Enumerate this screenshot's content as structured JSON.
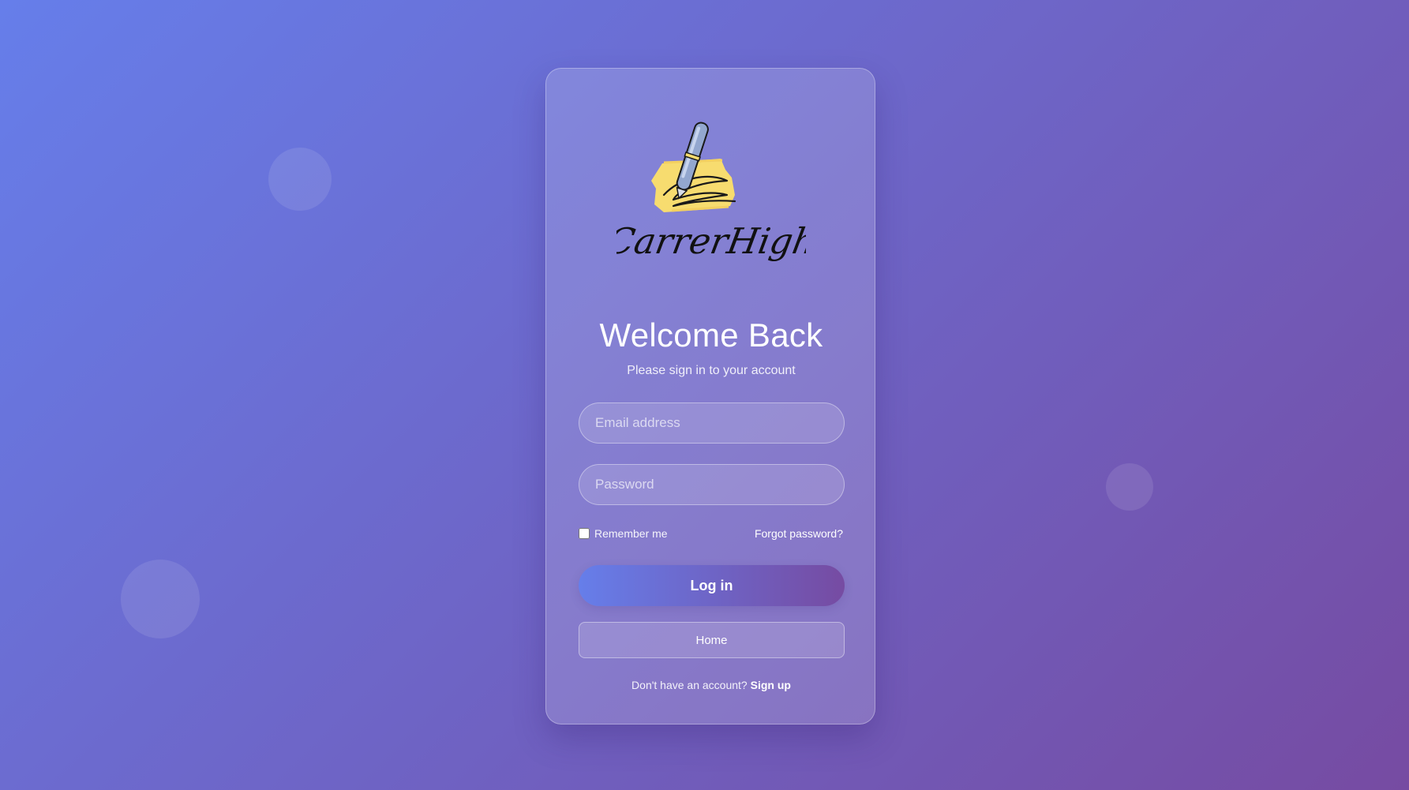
{
  "brand": {
    "name": "CarrerHigh",
    "colors": {
      "background_start": "#667eea",
      "background_end": "#764ba2",
      "logo_highlight": "#f7dc6f"
    }
  },
  "login": {
    "title": "Welcome Back",
    "subtitle": "Please sign in to your account",
    "email_placeholder": "Email address",
    "password_placeholder": "Password",
    "remember_label": "Remember me",
    "forgot_label": "Forgot password?",
    "login_label": "Log in",
    "home_label": "Home",
    "signup_prompt": "Don't have an account?",
    "signup_label": "Sign up"
  }
}
